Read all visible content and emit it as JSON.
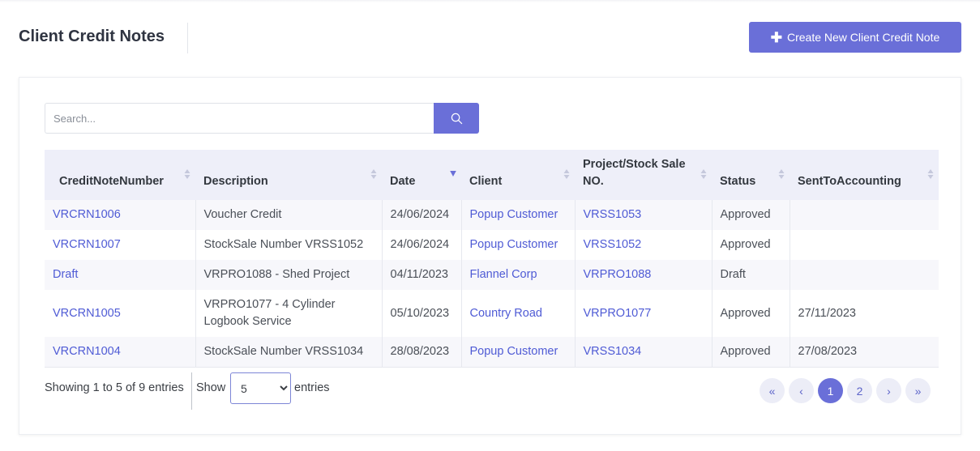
{
  "header": {
    "title": "Client Credit Notes",
    "create_label": "Create New Client Credit Note"
  },
  "search": {
    "placeholder": "Search..."
  },
  "table": {
    "columns": [
      "CreditNoteNumber",
      "Description",
      "Date",
      "Client",
      "Project/Stock Sale NO.",
      "Status",
      "SentToAccounting"
    ],
    "rows": [
      [
        "VRCRN1006",
        "Voucher Credit",
        "24/06/2024",
        "Popup Customer",
        "VRSS1053",
        "Approved",
        ""
      ],
      [
        "VRCRN1007",
        "StockSale Number VRSS1052",
        "24/06/2024",
        "Popup Customer",
        "VRSS1052",
        "Approved",
        ""
      ],
      [
        "Draft",
        "VRPRO1088 - Shed Project",
        "04/11/2023",
        "Flannel Corp",
        "VRPRO1088",
        "Draft",
        ""
      ],
      [
        "VRCRN1005",
        "VRPRO1077 - 4 Cylinder Logbook Service",
        "05/10/2023",
        "Country Road",
        "VRPRO1077",
        "Approved",
        "27/11/2023"
      ],
      [
        "VRCRN1004",
        "StockSale Number VRSS1034",
        "28/08/2023",
        "Popup Customer",
        "VRSS1034",
        "Approved",
        "27/08/2023"
      ]
    ]
  },
  "footer": {
    "showing": "Showing 1 to 5 of 9 entries",
    "show_label": "Show",
    "length_value": "5",
    "length_options": [
      "5"
    ],
    "entries_label": "entries"
  },
  "pagination": {
    "first": "«",
    "prev": "‹",
    "pages": [
      "1",
      "2"
    ],
    "active_page": "1",
    "next": "›",
    "last": "»"
  },
  "colors": {
    "accent": "#6a6fd8",
    "link": "#4f5bd5",
    "header_bg": "#eeeff9"
  },
  "icons": {
    "create": "plus-icon",
    "search": "search-icon"
  }
}
